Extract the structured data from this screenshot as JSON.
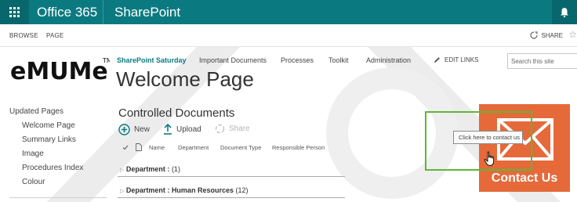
{
  "suite_bar": {
    "title": "Office 365",
    "app": "SharePoint",
    "color": "#0b7a80"
  },
  "ribbon": {
    "tabs": [
      "BROWSE",
      "PAGE"
    ],
    "share_label": "SHARE"
  },
  "logo": {
    "text": "eMUMe",
    "trademark": "TM"
  },
  "top_nav": {
    "items": [
      "SharePoint Saturday",
      "Important Documents",
      "Processes",
      "Toolkit",
      "Administration"
    ],
    "edit_links": "EDIT LINKS"
  },
  "search": {
    "placeholder": "Search this site"
  },
  "page": {
    "title": "Welcome Page"
  },
  "quick_launch": {
    "heading": "Updated Pages",
    "items": [
      "Welcome Page",
      "Summary Links",
      "Image",
      "Procedures Index",
      "Colour"
    ]
  },
  "library": {
    "title": "Controlled Documents",
    "commands": {
      "new": "New",
      "upload": "Upload",
      "share": "Share"
    },
    "columns": [
      "Name",
      "Department",
      "Document Type",
      "Responsible Person"
    ],
    "groups": [
      {
        "label": "Department :",
        "value": "",
        "count": "(1)"
      },
      {
        "label": "Department :",
        "value": "Human Resources",
        "count": "(12)"
      }
    ]
  },
  "contact": {
    "label": "Contact Us",
    "tooltip": "Click here to contact us",
    "color": "#e6693a"
  }
}
